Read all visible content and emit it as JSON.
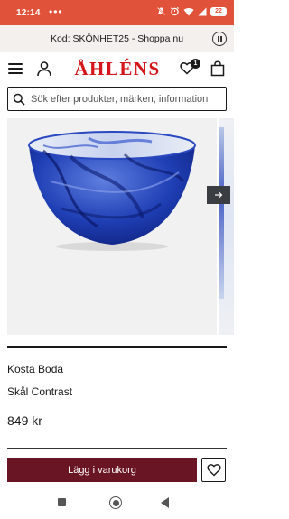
{
  "status_bar": {
    "time": "12:14",
    "dots": "•••",
    "battery": "22",
    "icons": [
      "mute-icon",
      "alarm-icon",
      "wifi-icon",
      "signal-icon",
      "battery-icon"
    ]
  },
  "promo": {
    "text": "Kod: SKÖNHET25 - Shoppa nu",
    "pause_icon": "pause-icon"
  },
  "header": {
    "logo": "ÅHLÉNS",
    "wishlist_badge": "1",
    "icons": [
      "menu-icon",
      "user-icon",
      "heart-icon",
      "bag-icon"
    ]
  },
  "search": {
    "placeholder": "Sök efter produkter, märken, information"
  },
  "gallery": {
    "arrow_icon": "arrow-right-icon"
  },
  "product": {
    "brand": "Kosta Boda",
    "name": "Skål Contrast",
    "price": "849 kr"
  },
  "actions": {
    "add_to_cart": "Lägg i varukorg",
    "wishlist_icon": "heart-icon"
  },
  "nav_bar": {
    "icons": [
      "square-back-icon",
      "circle-home-icon",
      "triangle-recent-icon"
    ]
  },
  "colors": {
    "status_bar": "#e0523a",
    "logo": "#d4151a",
    "cart_button": "#6a1523",
    "promo_bg": "#f3f0ee",
    "bowl_blue": "#1f3fb5"
  }
}
